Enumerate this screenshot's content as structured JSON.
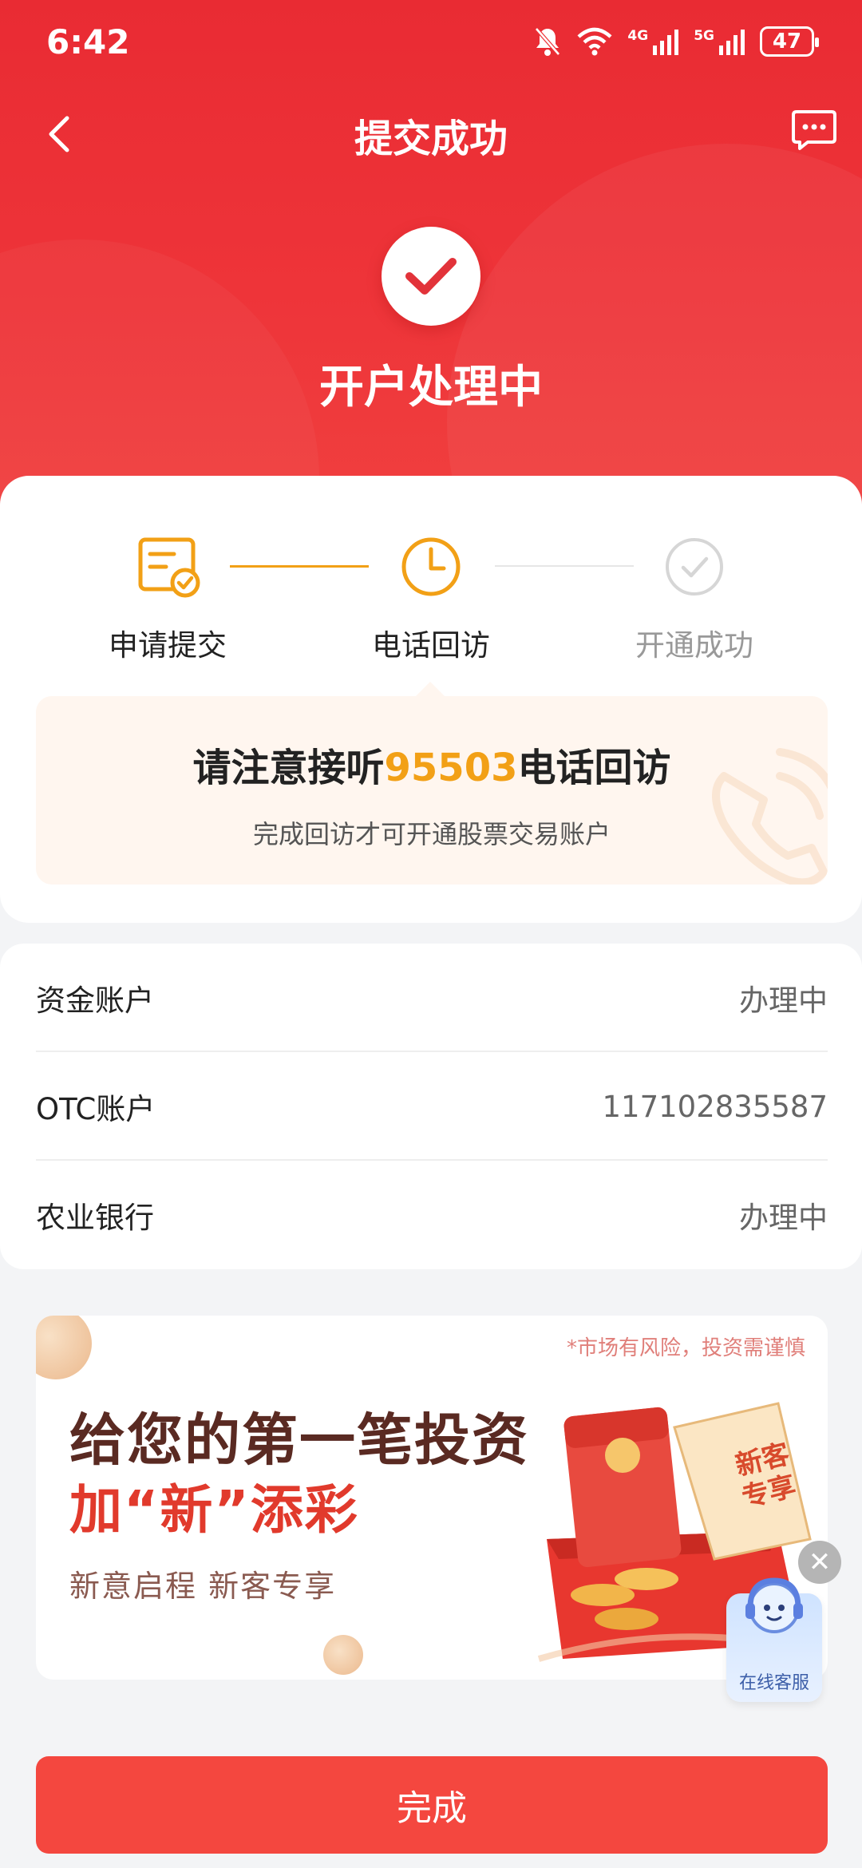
{
  "status_bar": {
    "time": "6:42",
    "net1": "4G",
    "net2": "5G",
    "battery": "47"
  },
  "navbar": {
    "title": "提交成功"
  },
  "hero": {
    "title": "开户处理中"
  },
  "steps": [
    {
      "label": "申请提交",
      "state": "done"
    },
    {
      "label": "电话回访",
      "state": "current"
    },
    {
      "label": "开通成功",
      "state": "pending"
    }
  ],
  "notice": {
    "prefix": "请注意接听",
    "phone": "95503",
    "suffix": "电话回访",
    "subtitle": "完成回访才可开通股票交易账户"
  },
  "accounts": [
    {
      "name": "资金账户",
      "value": "办理中"
    },
    {
      "name": "OTC账户",
      "value": "117102835587"
    },
    {
      "name": "农业银行",
      "value": "办理中"
    }
  ],
  "banner": {
    "risk": "*市场有风险，投资需谨慎",
    "line1": "给您的第一笔投资",
    "line2": "加“新”添彩",
    "line3": "新意启程 新客专享",
    "stamp": "新客专享"
  },
  "support": {
    "label": "在线客服"
  },
  "done_button": {
    "label": "完成"
  },
  "colors": {
    "primary_red": "#ee3439",
    "accent_orange": "#f2a016",
    "button_red": "#f4473f"
  }
}
